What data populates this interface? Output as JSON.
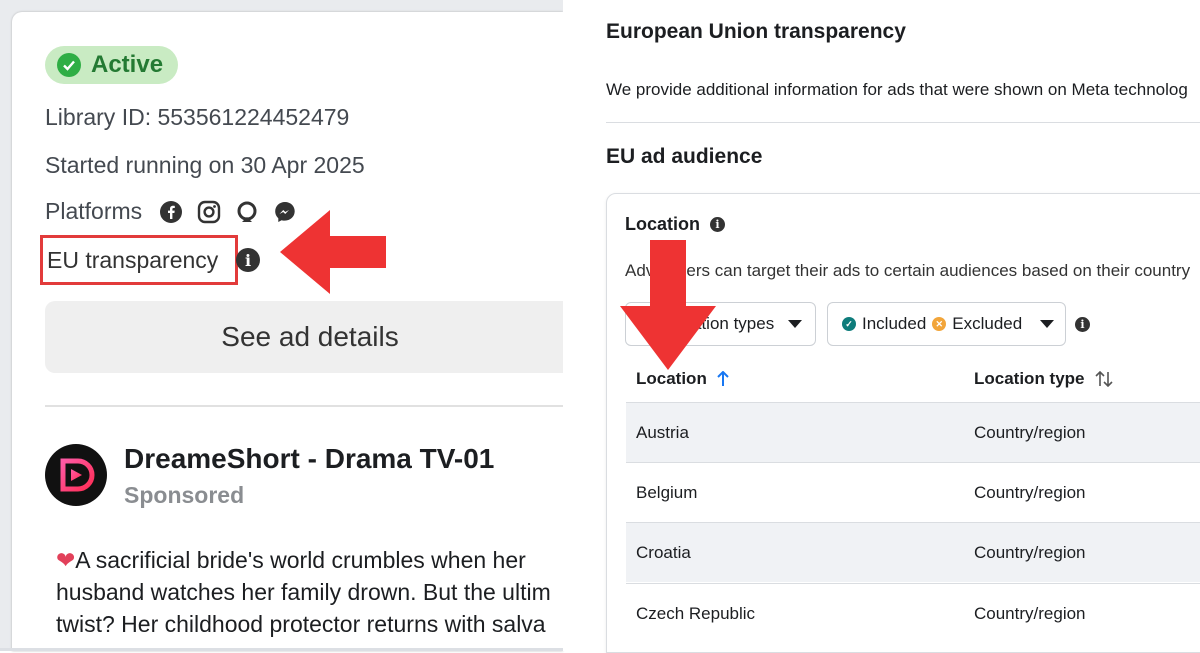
{
  "left": {
    "status": "Active",
    "library_id": "Library ID: 553561224452479",
    "started": "Started running on 30 Apr 2025",
    "platforms_label": "Platforms",
    "platform_icons": [
      "facebook-icon",
      "instagram-icon",
      "audience-network-icon",
      "messenger-icon"
    ],
    "eu_transparency": "EU transparency",
    "see_details": "See ad details",
    "advertiser": "DreameShort - Drama TV-01",
    "sponsored": "Sponsored",
    "body_lines": [
      "A sacrificial bride's world crumbles when her",
      "husband watches her family drown. But the ultim",
      "twist? Her childhood protector returns with salva"
    ]
  },
  "right": {
    "title": "European Union transparency",
    "description": "We provide additional information for ads that were shown on Meta technolog",
    "subtitle": "EU ad audience",
    "location_heading": "Location",
    "location_desc": "Advertisers can target their ads to certain audiences based on their country",
    "filter1": "ation types",
    "filter2_included": "Included",
    "filter2_excluded": "Excluded",
    "columns": [
      "Location",
      "Location type"
    ],
    "rows": [
      {
        "location": "Austria",
        "type": "Country/region"
      },
      {
        "location": "Belgium",
        "type": "Country/region"
      },
      {
        "location": "Croatia",
        "type": "Country/region"
      },
      {
        "location": "Czech Republic",
        "type": "Country/region"
      }
    ]
  },
  "colors": {
    "arrow": "#ee3333",
    "active_green": "#2fae45",
    "highlight_box": "#e23b3b",
    "sort_blue": "#1877f2"
  }
}
